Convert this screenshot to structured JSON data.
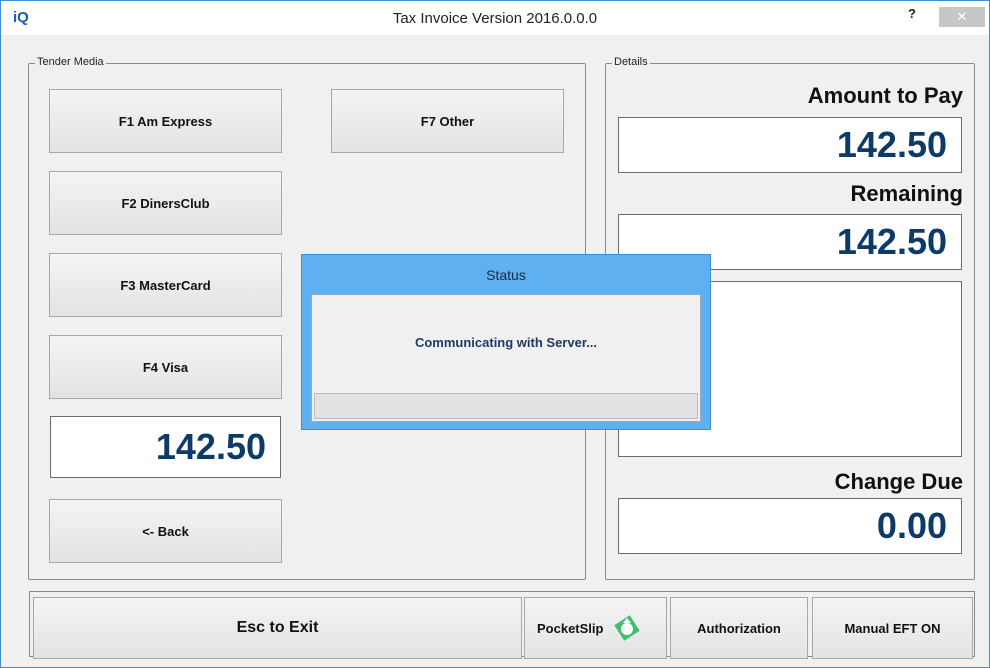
{
  "window": {
    "logo": "iQ",
    "title": "Tax Invoice Version 2016.0.0.0",
    "help": "?",
    "close": "✕"
  },
  "tender": {
    "legend": "Tender Media",
    "buttons": {
      "amex": "F1 Am Express",
      "diners": "F2 DinersClub",
      "master": "F3 MasterCard",
      "visa": "F4 Visa",
      "other": "F7 Other",
      "back": "<- Back"
    },
    "amount": "142.50"
  },
  "details": {
    "legend": "Details",
    "amount_to_pay_label": "Amount to Pay",
    "amount_to_pay": "142.50",
    "remaining_label": "Remaining",
    "remaining": "142.50",
    "change_due_label": "Change Due",
    "change_due": "0.00"
  },
  "bottom": {
    "exit": "Esc to Exit",
    "pocketslip": "PocketSlip",
    "authorization": "Authorization",
    "manual_eft": "Manual EFT ON"
  },
  "status": {
    "title": "Status",
    "message": "Communicating with Server..."
  },
  "colors": {
    "amount_text": "#0d3a66",
    "dialog_frame": "#5fb0f0",
    "pocketslip_icon": "#3fbf6f"
  }
}
